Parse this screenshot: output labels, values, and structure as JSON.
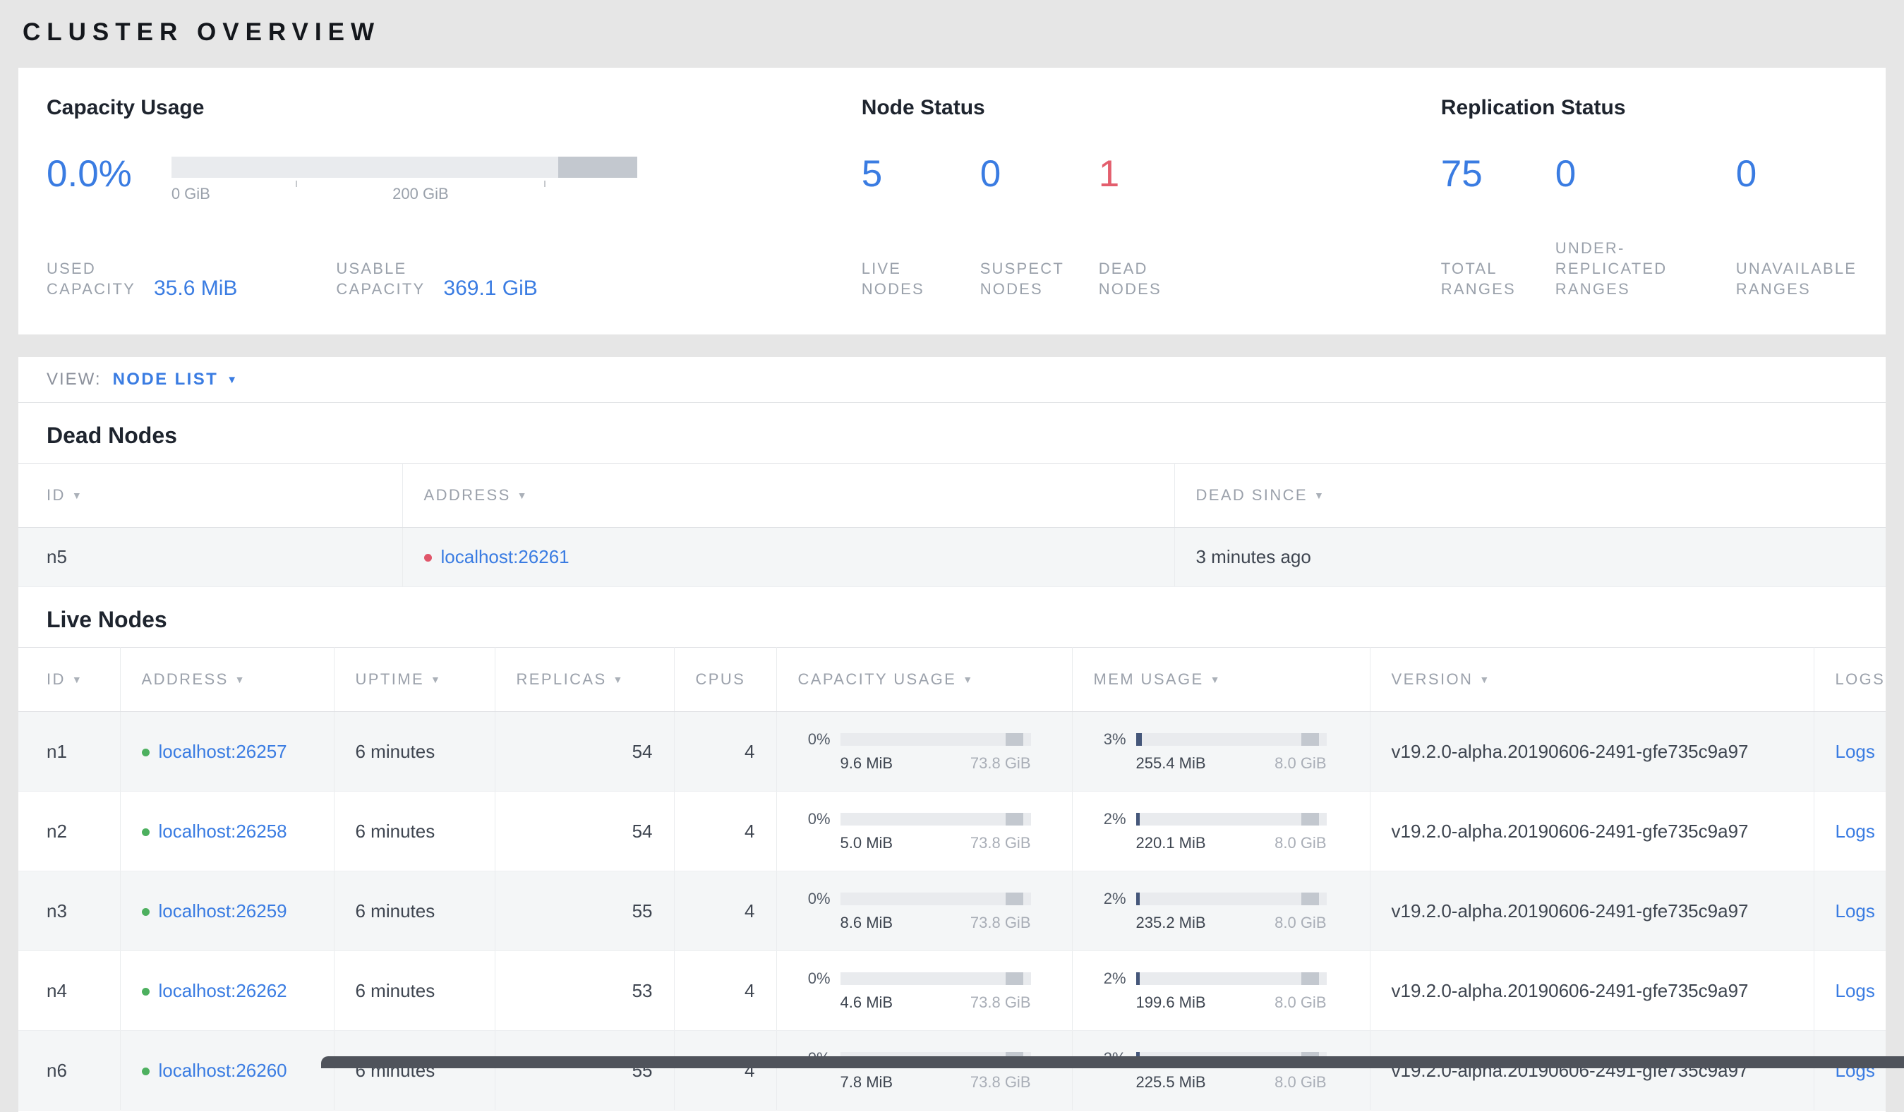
{
  "icons": {
    "sort_arrow": "▼",
    "caret_down": "▼"
  },
  "colors": {
    "accent_blue": "#3a7ce2",
    "danger_red": "#e35e6d",
    "live_green": "#4db05f",
    "dead_red": "#e0566a",
    "label_gray": "#9aa1ab"
  },
  "page": {
    "title": "CLUSTER OVERVIEW"
  },
  "summary": {
    "capacity": {
      "title": "Capacity Usage",
      "used_percent": "0.0%",
      "axis_labels": [
        "0 GiB",
        "200 GiB"
      ],
      "stats": [
        {
          "label": "USED\nCAPACITY",
          "value": "35.6 MiB"
        },
        {
          "label": "USABLE\nCAPACITY",
          "value": "369.1 GiB"
        }
      ]
    },
    "node_status": {
      "title": "Node Status",
      "stats": [
        {
          "value": "5",
          "label": "LIVE\nNODES"
        },
        {
          "value": "0",
          "label": "SUSPECT\nNODES"
        },
        {
          "value": "1",
          "label": "DEAD\nNODES"
        }
      ]
    },
    "replication_status": {
      "title": "Replication Status",
      "stats": [
        {
          "value": "75",
          "label": "TOTAL\nRANGES"
        },
        {
          "value": "0",
          "label": "UNDER-\nREPLICATED\nRANGES"
        },
        {
          "value": "0",
          "label": "UNAVAILABLE\nRANGES"
        }
      ]
    }
  },
  "view_bar": {
    "label": "VIEW:",
    "selected": "NODE LIST"
  },
  "dead_nodes": {
    "title": "Dead Nodes",
    "columns": [
      "ID",
      "ADDRESS",
      "DEAD SINCE"
    ],
    "rows": [
      {
        "id": "n5",
        "address": "localhost:26261",
        "dead_since": "3 minutes ago"
      }
    ]
  },
  "live_nodes": {
    "title": "Live Nodes",
    "logs_label": "Logs",
    "columns": [
      "ID",
      "ADDRESS",
      "UPTIME",
      "REPLICAS",
      "CPUS",
      "CAPACITY USAGE",
      "MEM USAGE",
      "VERSION",
      "LOGS"
    ],
    "rows": [
      {
        "id": "n1",
        "address": "localhost:26257",
        "uptime": "6 minutes",
        "replicas": "54",
        "cpus": "4",
        "capacity": {
          "percent": "0%",
          "used": "9.6 MiB",
          "total": "73.8 GiB"
        },
        "mem": {
          "percent": "3%",
          "used": "255.4 MiB",
          "total": "8.0 GiB"
        },
        "version": "v19.2.0-alpha.20190606-2491-gfe735c9a97"
      },
      {
        "id": "n2",
        "address": "localhost:26258",
        "uptime": "6 minutes",
        "replicas": "54",
        "cpus": "4",
        "capacity": {
          "percent": "0%",
          "used": "5.0 MiB",
          "total": "73.8 GiB"
        },
        "mem": {
          "percent": "2%",
          "used": "220.1 MiB",
          "total": "8.0 GiB"
        },
        "version": "v19.2.0-alpha.20190606-2491-gfe735c9a97"
      },
      {
        "id": "n3",
        "address": "localhost:26259",
        "uptime": "6 minutes",
        "replicas": "55",
        "cpus": "4",
        "capacity": {
          "percent": "0%",
          "used": "8.6 MiB",
          "total": "73.8 GiB"
        },
        "mem": {
          "percent": "2%",
          "used": "235.2 MiB",
          "total": "8.0 GiB"
        },
        "version": "v19.2.0-alpha.20190606-2491-gfe735c9a97"
      },
      {
        "id": "n4",
        "address": "localhost:26262",
        "uptime": "6 minutes",
        "replicas": "53",
        "cpus": "4",
        "capacity": {
          "percent": "0%",
          "used": "4.6 MiB",
          "total": "73.8 GiB"
        },
        "mem": {
          "percent": "2%",
          "used": "199.6 MiB",
          "total": "8.0 GiB"
        },
        "version": "v19.2.0-alpha.20190606-2491-gfe735c9a97"
      },
      {
        "id": "n6",
        "address": "localhost:26260",
        "uptime": "6 minutes",
        "replicas": "55",
        "cpus": "4",
        "capacity": {
          "percent": "0%",
          "used": "7.8 MiB",
          "total": "73.8 GiB"
        },
        "mem": {
          "percent": "2%",
          "used": "225.5 MiB",
          "total": "8.0 GiB"
        },
        "version": "v19.2.0-alpha.20190606-2491-gfe735c9a97"
      }
    ]
  }
}
